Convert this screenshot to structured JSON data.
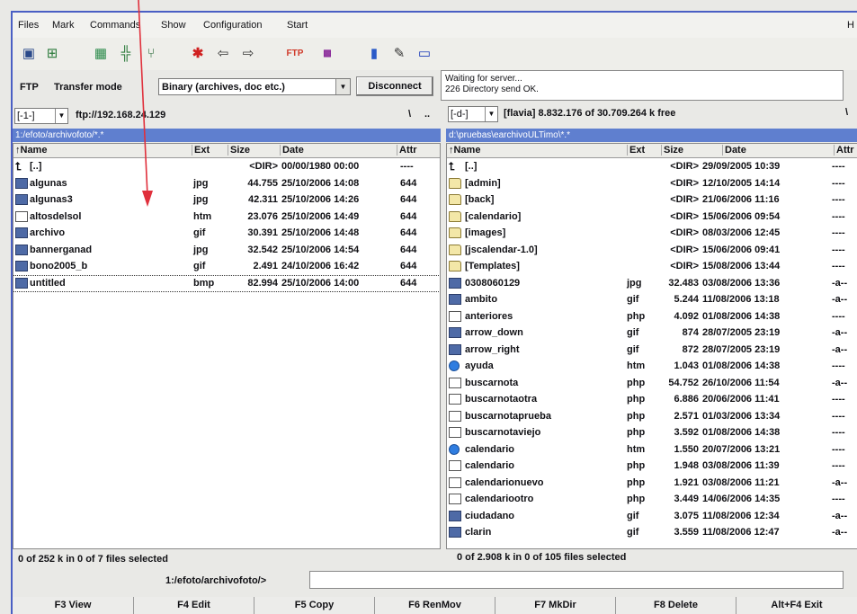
{
  "menu": [
    "Files",
    "Mark",
    "Commands",
    "Show",
    "Configuration",
    "Start"
  ],
  "menu_right": "H",
  "toolbar_icons": [
    "save-icon",
    "tree-icon",
    "grid-icon",
    "split-icon",
    "branch-icon",
    "asterisk-icon",
    "arrow-left-icon",
    "arrow-right-icon",
    "ftp-connect-icon",
    "ftp-disconnect-icon",
    "book-icon",
    "edit-icon",
    "window-icon"
  ],
  "ftp": {
    "label": "FTP",
    "transfer_label": "Transfer mode",
    "transfer_value": "Binary (archives, doc etc.)",
    "disconnect_label": "Disconnect",
    "status_line1": "Waiting for server...",
    "status_line2": "226 Directory send OK."
  },
  "left": {
    "drive": "[-1-]",
    "drive_info": "ftp://192.168.24.129",
    "back": "\\",
    "up": "..",
    "path": "1:/efoto/archivofoto/*.*",
    "columns": [
      "↑Name",
      "Ext",
      "Size",
      "Date",
      "Attr"
    ],
    "rows": [
      {
        "icon": "up",
        "name": "[..]",
        "ext": "",
        "size": "<DIR>",
        "date": "00/00/1980 00:00",
        "attr": "----"
      },
      {
        "icon": "img",
        "name": "algunas",
        "ext": "jpg",
        "size": "44.755",
        "date": "25/10/2006 14:08",
        "attr": "644"
      },
      {
        "icon": "img",
        "name": "algunas3",
        "ext": "jpg",
        "size": "42.311",
        "date": "25/10/2006 14:26",
        "attr": "644"
      },
      {
        "icon": "doc",
        "name": "altosdelsol",
        "ext": "htm",
        "size": "23.076",
        "date": "25/10/2006 14:49",
        "attr": "644"
      },
      {
        "icon": "img",
        "name": "archivo",
        "ext": "gif",
        "size": "30.391",
        "date": "25/10/2006 14:48",
        "attr": "644"
      },
      {
        "icon": "img",
        "name": "bannerganad",
        "ext": "jpg",
        "size": "32.542",
        "date": "25/10/2006 14:54",
        "attr": "644"
      },
      {
        "icon": "img",
        "name": "bono2005_b",
        "ext": "gif",
        "size": "2.491",
        "date": "24/10/2006 16:42",
        "attr": "644"
      },
      {
        "icon": "img",
        "name": "untitled",
        "ext": "bmp",
        "size": "82.994",
        "date": "25/10/2006 14:00",
        "attr": "644"
      }
    ],
    "footer": "0 of 252 k in 0 of 7 files selected"
  },
  "right": {
    "drive": "[-d-]",
    "drive_info": "[flavia]  8.832.176 of 30.709.264 k free",
    "back": "\\",
    "path": "d:\\pruebas\\earchivoULTimo\\*.*",
    "columns": [
      "↑Name",
      "Ext",
      "Size",
      "Date",
      "Attr"
    ],
    "rows": [
      {
        "icon": "up",
        "name": "[..]",
        "ext": "",
        "size": "<DIR>",
        "date": "29/09/2005 10:39",
        "attr": "----"
      },
      {
        "icon": "folder",
        "name": "[admin]",
        "ext": "",
        "size": "<DIR>",
        "date": "12/10/2005 14:14",
        "attr": "----"
      },
      {
        "icon": "folder",
        "name": "[back]",
        "ext": "",
        "size": "<DIR>",
        "date": "21/06/2006 11:16",
        "attr": "----"
      },
      {
        "icon": "folder",
        "name": "[calendario]",
        "ext": "",
        "size": "<DIR>",
        "date": "15/06/2006 09:54",
        "attr": "----"
      },
      {
        "icon": "folder",
        "name": "[images]",
        "ext": "",
        "size": "<DIR>",
        "date": "08/03/2006 12:45",
        "attr": "----"
      },
      {
        "icon": "folder",
        "name": "[jscalendar-1.0]",
        "ext": "",
        "size": "<DIR>",
        "date": "15/06/2006 09:41",
        "attr": "----"
      },
      {
        "icon": "folder",
        "name": "[Templates]",
        "ext": "",
        "size": "<DIR>",
        "date": "15/08/2006 13:44",
        "attr": "----"
      },
      {
        "icon": "img",
        "name": "0308060129",
        "ext": "jpg",
        "size": "32.483",
        "date": "03/08/2006 13:36",
        "attr": "-a--"
      },
      {
        "icon": "img",
        "name": "ambito",
        "ext": "gif",
        "size": "5.244",
        "date": "11/08/2006 13:18",
        "attr": "-a--"
      },
      {
        "icon": "doc",
        "name": "anteriores",
        "ext": "php",
        "size": "4.092",
        "date": "01/08/2006 14:38",
        "attr": "----"
      },
      {
        "icon": "img",
        "name": "arrow_down",
        "ext": "gif",
        "size": "874",
        "date": "28/07/2005 23:19",
        "attr": "-a--"
      },
      {
        "icon": "img",
        "name": "arrow_right",
        "ext": "gif",
        "size": "872",
        "date": "28/07/2005 23:19",
        "attr": "-a--"
      },
      {
        "icon": "web",
        "name": "ayuda",
        "ext": "htm",
        "size": "1.043",
        "date": "01/08/2006 14:38",
        "attr": "----"
      },
      {
        "icon": "doc",
        "name": "buscarnota",
        "ext": "php",
        "size": "54.752",
        "date": "26/10/2006 11:54",
        "attr": "-a--"
      },
      {
        "icon": "doc",
        "name": "buscarnotaotra",
        "ext": "php",
        "size": "6.886",
        "date": "20/06/2006 11:41",
        "attr": "----"
      },
      {
        "icon": "doc",
        "name": "buscarnotaprueba",
        "ext": "php",
        "size": "2.571",
        "date": "01/03/2006 13:34",
        "attr": "----"
      },
      {
        "icon": "doc",
        "name": "buscarnotaviejo",
        "ext": "php",
        "size": "3.592",
        "date": "01/08/2006 14:38",
        "attr": "----"
      },
      {
        "icon": "web",
        "name": "calendario",
        "ext": "htm",
        "size": "1.550",
        "date": "20/07/2006 13:21",
        "attr": "----"
      },
      {
        "icon": "doc",
        "name": "calendario",
        "ext": "php",
        "size": "1.948",
        "date": "03/08/2006 11:39",
        "attr": "----"
      },
      {
        "icon": "doc",
        "name": "calendarionuevo",
        "ext": "php",
        "size": "1.921",
        "date": "03/08/2006 11:21",
        "attr": "-a--"
      },
      {
        "icon": "doc",
        "name": "calendariootro",
        "ext": "php",
        "size": "3.449",
        "date": "14/06/2006 14:35",
        "attr": "----"
      },
      {
        "icon": "img",
        "name": "ciudadano",
        "ext": "gif",
        "size": "3.075",
        "date": "11/08/2006 12:34",
        "attr": "-a--"
      },
      {
        "icon": "img",
        "name": "clarin",
        "ext": "gif",
        "size": "3.559",
        "date": "11/08/2006 12:47",
        "attr": "-a--"
      }
    ],
    "footer": "0 of 2.908 k in 0 of 105 files selected"
  },
  "cmdline": {
    "path": "1:/efoto/archivofoto/>"
  },
  "fkeys": [
    "F3 View",
    "F4 Edit",
    "F5 Copy",
    "F6 RenMov",
    "F7 MkDir",
    "F8 Delete",
    "Alt+F4 Exit"
  ],
  "colors": {
    "path_active": "#5f7fcf",
    "annotation_arrow": "#e0303c",
    "window_frame": "#4a5fc4"
  }
}
